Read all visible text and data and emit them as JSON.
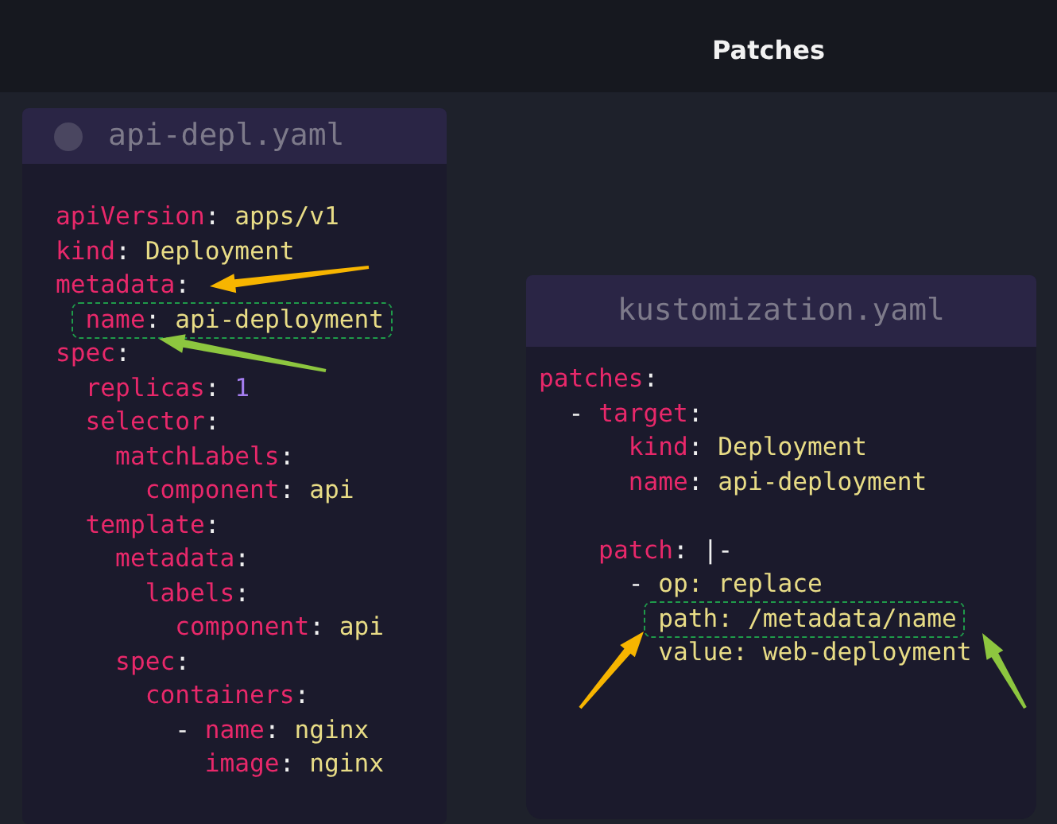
{
  "title": "Patches",
  "files": [
    {
      "name": "api-depl.yaml",
      "lines": [
        {
          "kind": "code",
          "parts": [
            {
              "text": "apiVersion",
              "kind": "key"
            },
            {
              "text": ": ",
              "kind": "punct"
            },
            {
              "text": "apps/v1",
              "kind": "value"
            }
          ]
        },
        {
          "kind": "code",
          "parts": [
            {
              "text": "kind",
              "kind": "key"
            },
            {
              "text": ": ",
              "kind": "punct"
            },
            {
              "text": "Deployment",
              "kind": "value"
            }
          ]
        },
        {
          "kind": "code",
          "parts": [
            {
              "text": "metadata",
              "kind": "key"
            },
            {
              "text": ":",
              "kind": "punct"
            }
          ]
        },
        {
          "kind": "code",
          "highlighted": true,
          "parts": [
            {
              "text": "  name",
              "kind": "key"
            },
            {
              "text": ": ",
              "kind": "punct"
            },
            {
              "text": "api-deployment",
              "kind": "value"
            }
          ]
        },
        {
          "kind": "code",
          "parts": [
            {
              "text": "spec",
              "kind": "key"
            },
            {
              "text": ":",
              "kind": "punct"
            }
          ]
        },
        {
          "kind": "code",
          "parts": [
            {
              "text": "  replicas",
              "kind": "key"
            },
            {
              "text": ": ",
              "kind": "punct"
            },
            {
              "text": "1",
              "kind": "number"
            }
          ]
        },
        {
          "kind": "code",
          "parts": [
            {
              "text": "  selector",
              "kind": "key"
            },
            {
              "text": ":",
              "kind": "punct"
            }
          ]
        },
        {
          "kind": "code",
          "parts": [
            {
              "text": "    matchLabels",
              "kind": "key"
            },
            {
              "text": ":",
              "kind": "punct"
            }
          ]
        },
        {
          "kind": "code",
          "parts": [
            {
              "text": "      component",
              "kind": "key"
            },
            {
              "text": ": ",
              "kind": "punct"
            },
            {
              "text": "api",
              "kind": "value"
            }
          ]
        },
        {
          "kind": "code",
          "parts": [
            {
              "text": "  template",
              "kind": "key"
            },
            {
              "text": ":",
              "kind": "punct"
            }
          ]
        },
        {
          "kind": "code",
          "parts": [
            {
              "text": "    metadata",
              "kind": "key"
            },
            {
              "text": ":",
              "kind": "punct"
            }
          ]
        },
        {
          "kind": "code",
          "parts": [
            {
              "text": "      labels",
              "kind": "key"
            },
            {
              "text": ":",
              "kind": "punct"
            }
          ]
        },
        {
          "kind": "code",
          "parts": [
            {
              "text": "        component",
              "kind": "key"
            },
            {
              "text": ": ",
              "kind": "punct"
            },
            {
              "text": "api",
              "kind": "value"
            }
          ]
        },
        {
          "kind": "code",
          "parts": [
            {
              "text": "    spec",
              "kind": "key"
            },
            {
              "text": ":",
              "kind": "punct"
            }
          ]
        },
        {
          "kind": "code",
          "parts": [
            {
              "text": "      containers",
              "kind": "key"
            },
            {
              "text": ":",
              "kind": "punct"
            }
          ]
        },
        {
          "kind": "code",
          "parts": [
            {
              "text": "        - ",
              "kind": "punct"
            },
            {
              "text": "name",
              "kind": "key"
            },
            {
              "text": ": ",
              "kind": "punct"
            },
            {
              "text": "nginx",
              "kind": "value"
            }
          ]
        },
        {
          "kind": "code",
          "parts": [
            {
              "text": "          image",
              "kind": "key"
            },
            {
              "text": ": ",
              "kind": "punct"
            },
            {
              "text": "nginx",
              "kind": "value"
            }
          ]
        }
      ]
    },
    {
      "name": "kustomization.yaml",
      "lines": [
        {
          "kind": "code",
          "parts": [
            {
              "text": "patches",
              "kind": "key"
            },
            {
              "text": ":",
              "kind": "punct"
            }
          ]
        },
        {
          "kind": "code",
          "parts": [
            {
              "text": "  - ",
              "kind": "punct"
            },
            {
              "text": "target",
              "kind": "key"
            },
            {
              "text": ":",
              "kind": "punct"
            }
          ]
        },
        {
          "kind": "code",
          "parts": [
            {
              "text": "      kind",
              "kind": "key"
            },
            {
              "text": ": ",
              "kind": "punct"
            },
            {
              "text": "Deployment",
              "kind": "value"
            }
          ]
        },
        {
          "kind": "code",
          "parts": [
            {
              "text": "      name",
              "kind": "key"
            },
            {
              "text": ": ",
              "kind": "punct"
            },
            {
              "text": "api-deployment",
              "kind": "value"
            }
          ]
        },
        {
          "kind": "blank"
        },
        {
          "kind": "code",
          "parts": [
            {
              "text": "    patch",
              "kind": "key"
            },
            {
              "text": ": |-",
              "kind": "punct"
            }
          ]
        },
        {
          "kind": "code",
          "parts": [
            {
              "text": "      - ",
              "kind": "punct"
            },
            {
              "text": "op: replace",
              "kind": "value"
            }
          ]
        },
        {
          "kind": "code",
          "highlighted": true,
          "parts": [
            {
              "text": "        path: /metadata/name",
              "kind": "value"
            }
          ]
        },
        {
          "kind": "code",
          "parts": [
            {
              "text": "        value: web-deployment",
              "kind": "value"
            }
          ]
        }
      ]
    }
  ]
}
